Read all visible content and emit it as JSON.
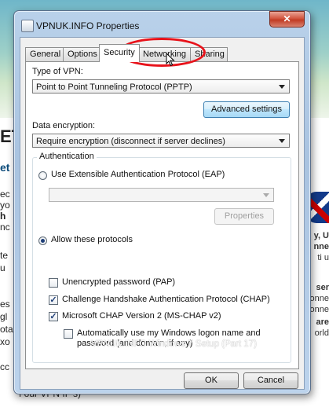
{
  "background_page": {
    "left_fragments": [
      "ET",
      "et",
      "ec",
      "yo",
      "h",
      "nc",
      "te",
      "u",
      "es",
      "gl",
      "ota",
      "xo",
      "cc",
      "f our VPN IP's)"
    ],
    "right_fragments": [
      "y, U",
      "nne",
      "ti u",
      "ser",
      "onne",
      "onne",
      "are",
      "orld"
    ]
  },
  "window": {
    "title": "VPNUK.INFO Properties",
    "close_label": "✕",
    "tabs": [
      {
        "label": "General"
      },
      {
        "label": "Options"
      },
      {
        "label": "Security"
      },
      {
        "label": "Networking"
      },
      {
        "label": "Sharing"
      }
    ],
    "active_tab": "Security",
    "vpn_type_label": "Type of VPN:",
    "vpn_type_value": "Point to Point Tunneling Protocol (PPTP)",
    "advanced_settings": "Advanced settings",
    "data_encryption_label": "Data encryption:",
    "data_encryption_value": "Require encryption (disconnect if server declines)",
    "authentication_title": "Authentication",
    "eap_option": "Use Extensible Authentication Protocol (EAP)",
    "eap_value": "",
    "properties_button": "Properties",
    "allow_protocols": "Allow these protocols",
    "protocols": [
      {
        "label": "Unencrypted password (PAP)",
        "checked": false
      },
      {
        "label": "Challenge Handshake Authentication Protocol (CHAP)",
        "checked": true
      },
      {
        "label": "Microsoft CHAP Version 2 (MS-CHAP v2)",
        "checked": true
      }
    ],
    "auto_logon_line1": "Automatically use my Windows logon name and",
    "auto_logon_line2": "password (and domain, if any)",
    "auto_logon_checked": false,
    "ok": "OK",
    "cancel": "Cancel"
  },
  "watermark": "VPNUK.INFO Windows 7 Setup (Part 17)",
  "colors": {
    "highlight_ellipse": "#e8131b",
    "accent": "#3c7fb1"
  }
}
